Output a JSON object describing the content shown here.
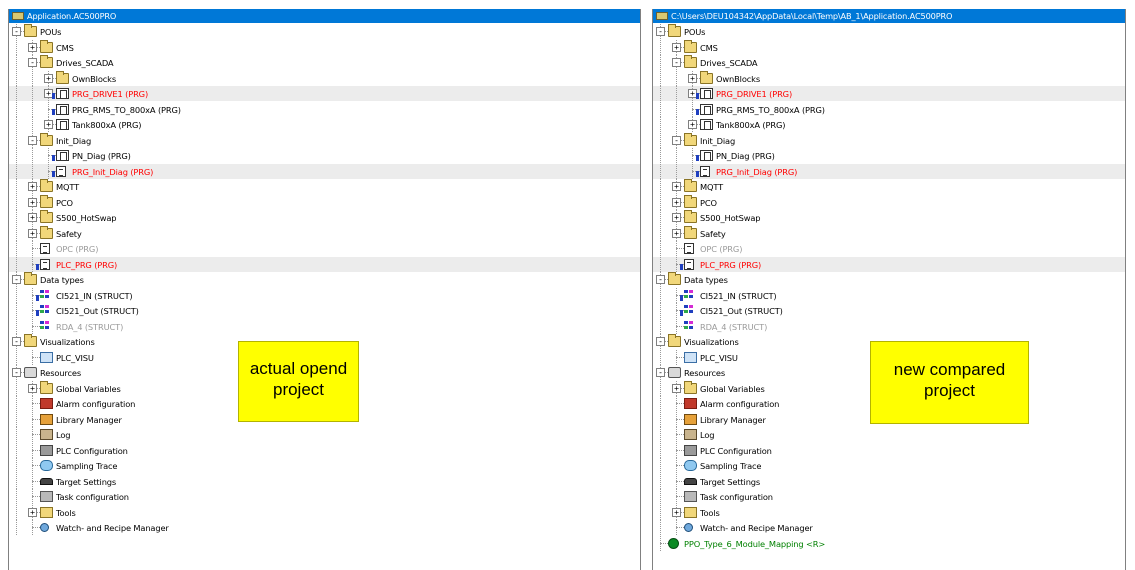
{
  "left": {
    "header": "Application.AC500PRO",
    "note_line1": "actual opend",
    "note_line2": "project",
    "items": [
      {
        "text": "POUs",
        "depth": 0,
        "exp": "-",
        "icon": "folder",
        "tone": "n"
      },
      {
        "text": "CMS",
        "depth": 1,
        "exp": "+",
        "icon": "folder",
        "tone": "n"
      },
      {
        "text": "Drives_SCADA",
        "depth": 1,
        "exp": "-",
        "icon": "folder",
        "tone": "n"
      },
      {
        "text": "OwnBlocks",
        "depth": 2,
        "exp": "+",
        "icon": "folder",
        "tone": "n"
      },
      {
        "text": "PRG_DRIVE1 (PRG)",
        "depth": 2,
        "exp": "+",
        "icon": "fb",
        "tone": "red",
        "arrow": true,
        "diff": true
      },
      {
        "text": "PRG_RMS_TO_800xA (PRG)",
        "depth": 2,
        "exp": "",
        "icon": "fb",
        "tone": "n",
        "arrow": true
      },
      {
        "text": "Tank800xA (PRG)",
        "depth": 2,
        "exp": "+",
        "icon": "fb",
        "tone": "n"
      },
      {
        "text": "Init_Diag",
        "depth": 1,
        "exp": "-",
        "icon": "folder",
        "tone": "n"
      },
      {
        "text": "PN_Diag (PRG)",
        "depth": 2,
        "exp": "",
        "icon": "fb",
        "tone": "n",
        "arrow": true
      },
      {
        "text": "PRG_Init_Diag (PRG)",
        "depth": 2,
        "exp": "",
        "icon": "prg",
        "tone": "red",
        "arrow": true,
        "diff": true
      },
      {
        "text": "MQTT",
        "depth": 1,
        "exp": "+",
        "icon": "folder",
        "tone": "n"
      },
      {
        "text": "PCO",
        "depth": 1,
        "exp": "+",
        "icon": "folder",
        "tone": "n"
      },
      {
        "text": "S500_HotSwap",
        "depth": 1,
        "exp": "+",
        "icon": "folder",
        "tone": "n"
      },
      {
        "text": "Safety",
        "depth": 1,
        "exp": "+",
        "icon": "folder",
        "tone": "n"
      },
      {
        "text": "OPC (PRG)",
        "depth": 1,
        "exp": "",
        "icon": "prg",
        "tone": "gray"
      },
      {
        "text": "PLC_PRG (PRG)",
        "depth": 1,
        "exp": "",
        "icon": "prg",
        "tone": "red",
        "arrow": true,
        "diff": true
      },
      {
        "text": "Data types",
        "depth": 0,
        "exp": "-",
        "icon": "folder",
        "tone": "n"
      },
      {
        "text": "CI521_IN (STRUCT)",
        "depth": 1,
        "exp": "",
        "icon": "dt",
        "tone": "n",
        "arrow": true
      },
      {
        "text": "CI521_Out (STRUCT)",
        "depth": 1,
        "exp": "",
        "icon": "dt",
        "tone": "n",
        "arrow": true
      },
      {
        "text": "RDA_4 (STRUCT)",
        "depth": 1,
        "exp": "",
        "icon": "dt",
        "tone": "gray"
      },
      {
        "text": "Visualizations",
        "depth": 0,
        "exp": "-",
        "icon": "folder",
        "tone": "n"
      },
      {
        "text": "PLC_VISU",
        "depth": 1,
        "exp": "",
        "icon": "visu",
        "tone": "n"
      },
      {
        "text": "Resources",
        "depth": 0,
        "exp": "-",
        "icon": "res",
        "tone": "n"
      },
      {
        "text": "Global Variables",
        "depth": 1,
        "exp": "+",
        "icon": "folder",
        "tone": "n"
      },
      {
        "text": "Alarm configuration",
        "depth": 1,
        "exp": "",
        "icon": "alarm",
        "tone": "n"
      },
      {
        "text": "Library Manager",
        "depth": 1,
        "exp": "",
        "icon": "lib",
        "tone": "n"
      },
      {
        "text": "Log",
        "depth": 1,
        "exp": "",
        "icon": "log",
        "tone": "n"
      },
      {
        "text": "PLC Configuration",
        "depth": 1,
        "exp": "",
        "icon": "plc",
        "tone": "n"
      },
      {
        "text": "Sampling Trace",
        "depth": 1,
        "exp": "",
        "icon": "trace",
        "tone": "n"
      },
      {
        "text": "Target Settings",
        "depth": 1,
        "exp": "",
        "icon": "target",
        "tone": "n"
      },
      {
        "text": "Task configuration",
        "depth": 1,
        "exp": "",
        "icon": "task",
        "tone": "n"
      },
      {
        "text": "Tools",
        "depth": 1,
        "exp": "+",
        "icon": "tools",
        "tone": "n"
      },
      {
        "text": "Watch- and Recipe Manager",
        "depth": 1,
        "exp": "",
        "icon": "watch",
        "tone": "n"
      }
    ]
  },
  "right": {
    "header": "C:\\Users\\DEU104342\\AppData\\Local\\Temp\\AB_1\\Application.AC500PRO",
    "note_line1": "new compared",
    "note_line2": "project",
    "items": [
      {
        "text": "POUs",
        "depth": 0,
        "exp": "-",
        "icon": "folder",
        "tone": "n"
      },
      {
        "text": "CMS",
        "depth": 1,
        "exp": "+",
        "icon": "folder",
        "tone": "n"
      },
      {
        "text": "Drives_SCADA",
        "depth": 1,
        "exp": "-",
        "icon": "folder",
        "tone": "n"
      },
      {
        "text": "OwnBlocks",
        "depth": 2,
        "exp": "+",
        "icon": "folder",
        "tone": "n"
      },
      {
        "text": "PRG_DRIVE1 (PRG)",
        "depth": 2,
        "exp": "+",
        "icon": "fb",
        "tone": "red",
        "arrow": true,
        "diff": true
      },
      {
        "text": "PRG_RMS_TO_800xA (PRG)",
        "depth": 2,
        "exp": "",
        "icon": "fb",
        "tone": "n",
        "arrow": true
      },
      {
        "text": "Tank800xA (PRG)",
        "depth": 2,
        "exp": "+",
        "icon": "fb",
        "tone": "n"
      },
      {
        "text": "Init_Diag",
        "depth": 1,
        "exp": "-",
        "icon": "folder",
        "tone": "n"
      },
      {
        "text": "PN_Diag (PRG)",
        "depth": 2,
        "exp": "",
        "icon": "fb",
        "tone": "n",
        "arrow": true
      },
      {
        "text": "PRG_Init_Diag (PRG)",
        "depth": 2,
        "exp": "",
        "icon": "prg",
        "tone": "red",
        "arrow": true,
        "diff": true
      },
      {
        "text": "MQTT",
        "depth": 1,
        "exp": "+",
        "icon": "folder",
        "tone": "n"
      },
      {
        "text": "PCO",
        "depth": 1,
        "exp": "+",
        "icon": "folder",
        "tone": "n"
      },
      {
        "text": "S500_HotSwap",
        "depth": 1,
        "exp": "+",
        "icon": "folder",
        "tone": "n"
      },
      {
        "text": "Safety",
        "depth": 1,
        "exp": "+",
        "icon": "folder",
        "tone": "n"
      },
      {
        "text": "OPC (PRG)",
        "depth": 1,
        "exp": "",
        "icon": "prg",
        "tone": "gray"
      },
      {
        "text": "PLC_PRG (PRG)",
        "depth": 1,
        "exp": "",
        "icon": "prg",
        "tone": "red",
        "arrow": true,
        "diff": true
      },
      {
        "text": "Data types",
        "depth": 0,
        "exp": "-",
        "icon": "folder",
        "tone": "n"
      },
      {
        "text": "CI521_IN (STRUCT)",
        "depth": 1,
        "exp": "",
        "icon": "dt",
        "tone": "n",
        "arrow": true
      },
      {
        "text": "CI521_Out (STRUCT)",
        "depth": 1,
        "exp": "",
        "icon": "dt",
        "tone": "n",
        "arrow": true
      },
      {
        "text": "RDA_4 (STRUCT)",
        "depth": 1,
        "exp": "",
        "icon": "dt",
        "tone": "gray"
      },
      {
        "text": "Visualizations",
        "depth": 0,
        "exp": "-",
        "icon": "folder",
        "tone": "n"
      },
      {
        "text": "PLC_VISU",
        "depth": 1,
        "exp": "",
        "icon": "visu",
        "tone": "n"
      },
      {
        "text": "Resources",
        "depth": 0,
        "exp": "-",
        "icon": "res",
        "tone": "n"
      },
      {
        "text": "Global Variables",
        "depth": 1,
        "exp": "+",
        "icon": "folder",
        "tone": "n"
      },
      {
        "text": "Alarm configuration",
        "depth": 1,
        "exp": "",
        "icon": "alarm",
        "tone": "n"
      },
      {
        "text": "Library Manager",
        "depth": 1,
        "exp": "",
        "icon": "lib",
        "tone": "n"
      },
      {
        "text": "Log",
        "depth": 1,
        "exp": "",
        "icon": "log",
        "tone": "n"
      },
      {
        "text": "PLC Configuration",
        "depth": 1,
        "exp": "",
        "icon": "plc",
        "tone": "n"
      },
      {
        "text": "Sampling Trace",
        "depth": 1,
        "exp": "",
        "icon": "trace",
        "tone": "n"
      },
      {
        "text": "Target Settings",
        "depth": 1,
        "exp": "",
        "icon": "target",
        "tone": "n"
      },
      {
        "text": "Task configuration",
        "depth": 1,
        "exp": "",
        "icon": "task",
        "tone": "n"
      },
      {
        "text": "Tools",
        "depth": 1,
        "exp": "+",
        "icon": "tools",
        "tone": "n"
      },
      {
        "text": "Watch- and Recipe Manager",
        "depth": 1,
        "exp": "",
        "icon": "watch",
        "tone": "n"
      },
      {
        "text": "PPO_Type_6_Module_Mapping <R>",
        "depth": 0,
        "exp": "",
        "icon": "globe",
        "tone": "green"
      }
    ]
  }
}
